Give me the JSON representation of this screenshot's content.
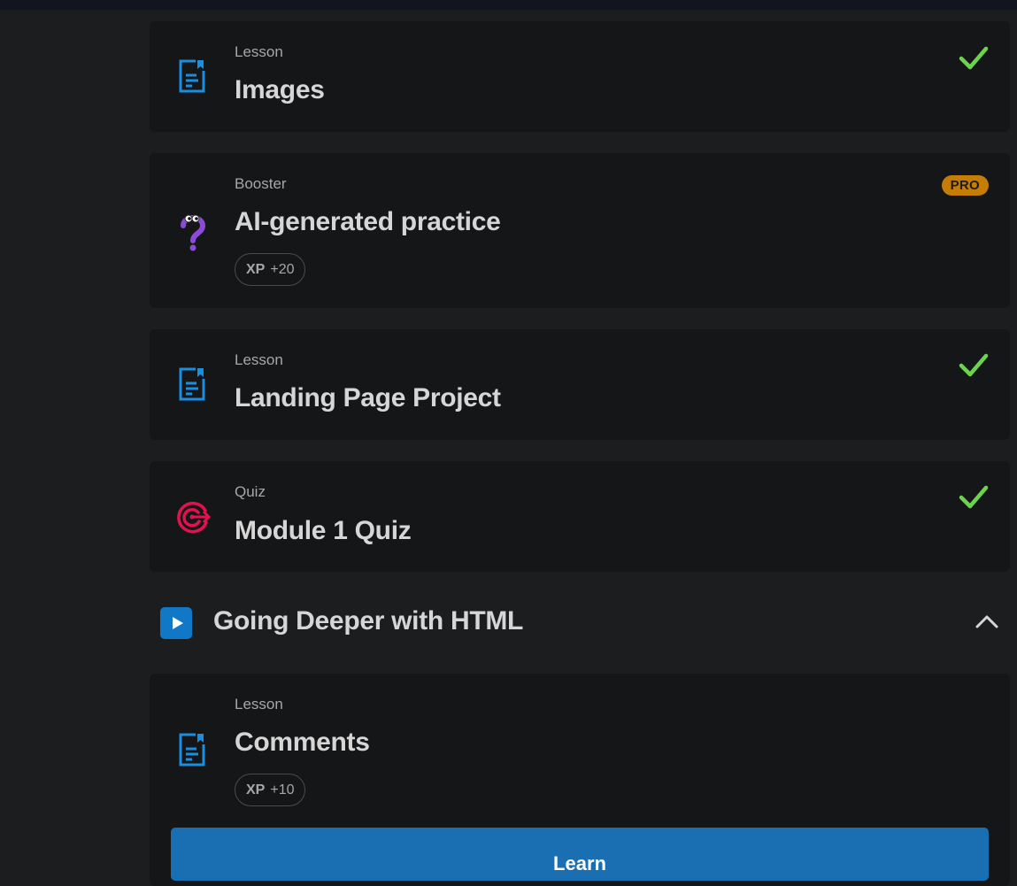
{
  "cards": [
    {
      "kind": "Lesson",
      "title": "Images",
      "completed": true,
      "icon": "lesson-document-icon"
    },
    {
      "kind": "Booster",
      "title": "AI-generated practice",
      "badge": "PRO",
      "xp_label": "XP",
      "xp_value": "+20",
      "icon": "question-mark-icon"
    },
    {
      "kind": "Lesson",
      "title": "Landing Page Project",
      "completed": true,
      "icon": "lesson-document-icon"
    },
    {
      "kind": "Quiz",
      "title": "Module 1 Quiz",
      "completed": true,
      "icon": "target-icon"
    }
  ],
  "module": {
    "title": "Going Deeper with HTML",
    "expanded": true
  },
  "current": {
    "kind": "Lesson",
    "title": "Comments",
    "xp_label": "XP",
    "xp_value": "+10",
    "button_label": "Learn",
    "icon": "lesson-document-icon"
  },
  "colors": {
    "accent": "#1a6fb3",
    "check": "#6bd34d",
    "pro": "#c67d06",
    "quiz": "#e3124e",
    "booster": "#8b4bd6"
  }
}
